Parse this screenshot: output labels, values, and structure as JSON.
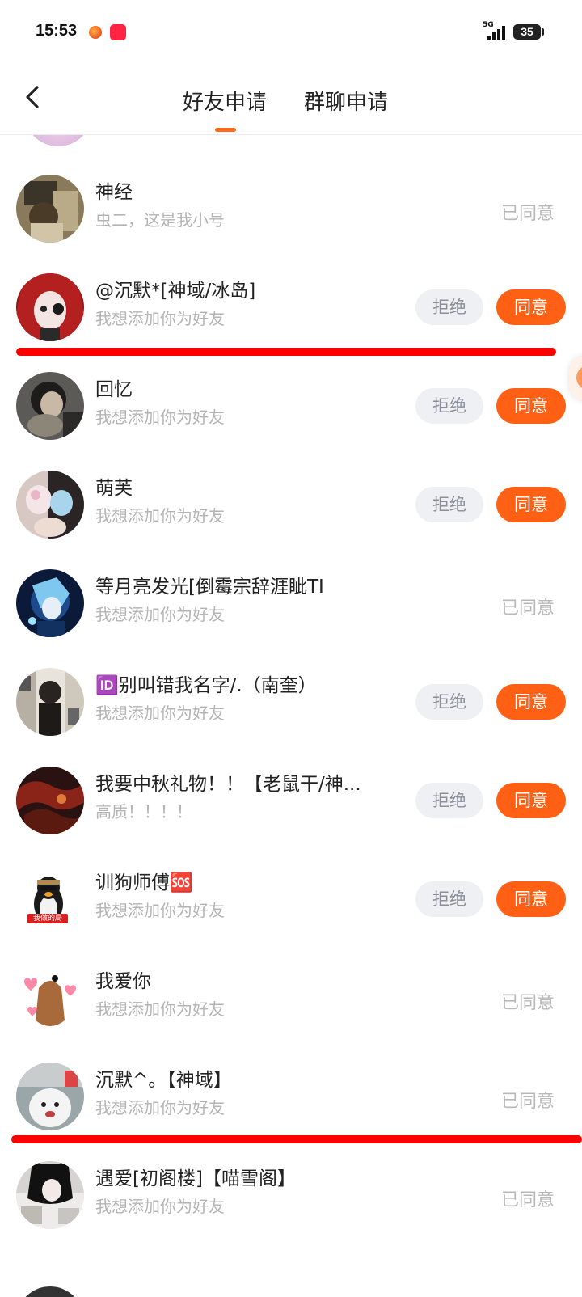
{
  "status_bar": {
    "time": "15:53",
    "network": "5G",
    "battery": "35"
  },
  "header": {
    "back_icon": "chevron-left-icon",
    "tabs": [
      {
        "label": "好友申请",
        "active": true
      },
      {
        "label": "群聊申请",
        "active": false
      }
    ],
    "accent_color": "#ff6a1a"
  },
  "actions": {
    "reject_label": "拒绝",
    "agree_label": "同意",
    "agreed_label": "已同意",
    "agree_color": "#ff6014"
  },
  "requests": [
    {
      "name": "神经",
      "message": "虫二，这是我小号",
      "status": "agreed"
    },
    {
      "name": "@沉默*[神域/冰岛]",
      "message": "我想添加你为好友",
      "status": "pending"
    },
    {
      "name": "回忆",
      "message": "我想添加你为好友",
      "status": "pending"
    },
    {
      "name": "萌芙",
      "message": "我想添加你为好友",
      "status": "pending"
    },
    {
      "name": "等月亮发光[倒霉宗辞涯眦TI",
      "message": "我想添加你为好友",
      "status": "agreed"
    },
    {
      "name": "🆔别叫错我名字/.（南奎）",
      "message": "我想添加你为好友",
      "status": "pending"
    },
    {
      "name": "我要中秋礼物！！【老鼠干/神...",
      "message": "高质！！！！",
      "status": "pending"
    },
    {
      "name": "训狗师傅🆘",
      "message": "我想添加你为好友",
      "status": "pending"
    },
    {
      "name": "我爱你",
      "message": "我想添加你为好友",
      "status": "agreed"
    },
    {
      "name": "沉默^。【神域】",
      "message": "我想添加你为好友",
      "status": "agreed"
    },
    {
      "name": "遇爱[初阁楼]【喵雪阁】",
      "message": "我想添加你为好友",
      "status": "agreed"
    }
  ],
  "avatar_badges": {
    "penguin_caption": "我做的局"
  },
  "annotation_color": "#ff0000"
}
